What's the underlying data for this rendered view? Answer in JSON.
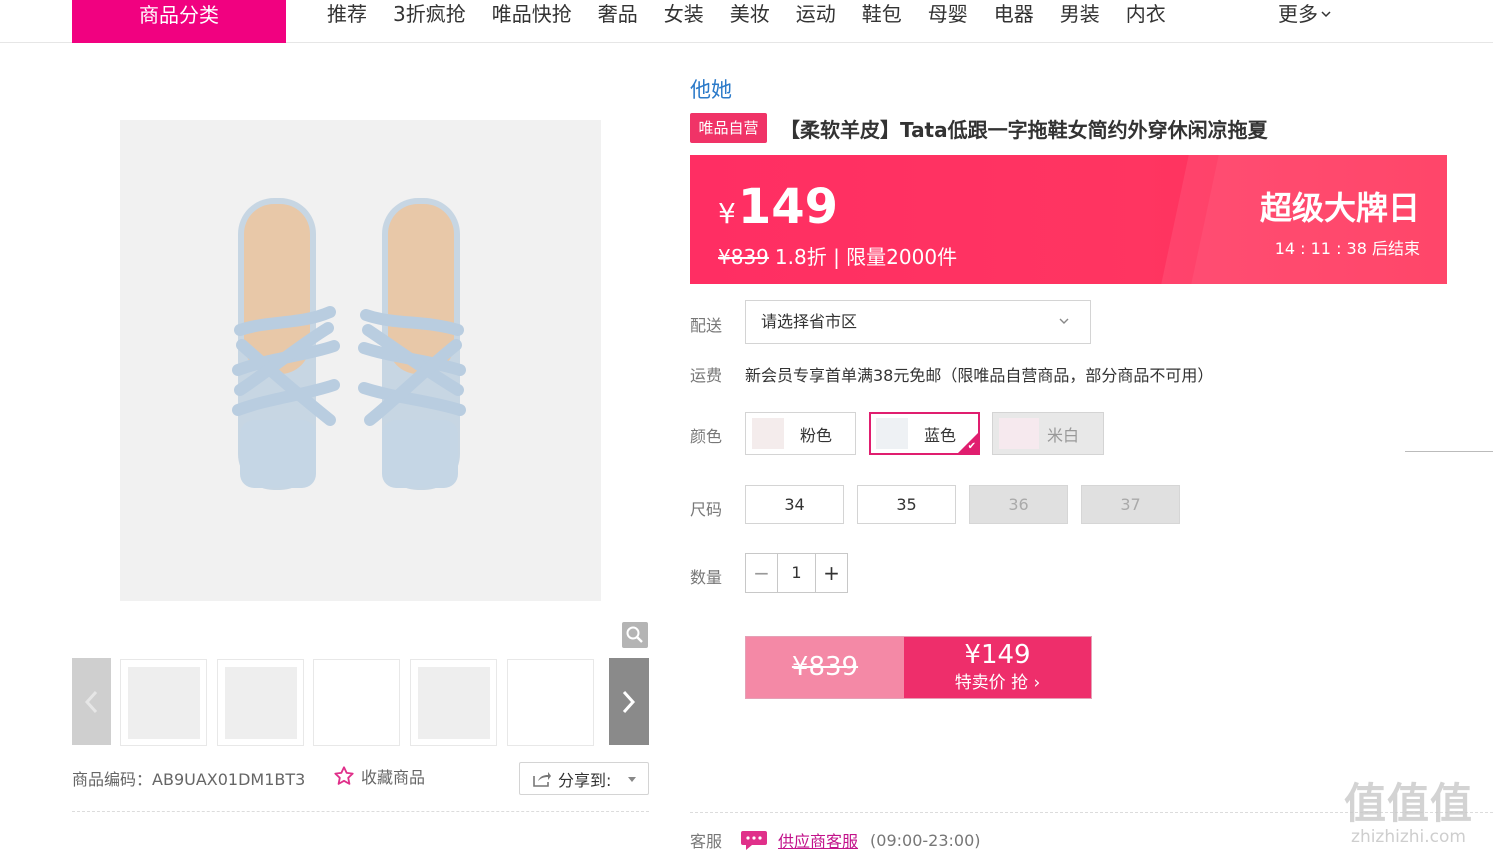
{
  "nav": {
    "category_button": "商品分类",
    "items": [
      "推荐",
      "3折疯抢",
      "唯品快抢",
      "奢品",
      "女装",
      "美妆",
      "运动",
      "鞋包",
      "母婴",
      "电器",
      "男装",
      "内衣"
    ],
    "more": "更多"
  },
  "gallery": {
    "product_code_label": "商品编码：",
    "product_code": "AB9UAX01DM1BT3",
    "favorite_label": "收藏商品",
    "share_label": "分享到:"
  },
  "product": {
    "brand": "他她",
    "self_badge": "唯品自营",
    "title": "【柔软羊皮】Tata低跟一字拖鞋女简约外穿休闲凉拖夏"
  },
  "price_banner": {
    "currency": "¥",
    "price": "149",
    "original_price": "¥839",
    "discount_info": "1.8折 | 限量2000件",
    "event_title": "超级大牌日",
    "countdown": "14 : 11 : 38  后结束"
  },
  "delivery": {
    "label": "配送",
    "placeholder": "请选择省市区"
  },
  "shipping": {
    "label": "运费",
    "text": "新会员专享首单满38元免邮（限唯品自营商品，部分商品不可用）"
  },
  "color": {
    "label": "颜色",
    "options": [
      {
        "name": "粉色",
        "state": "available"
      },
      {
        "name": "蓝色",
        "state": "selected"
      },
      {
        "name": "米白",
        "state": "disabled"
      }
    ]
  },
  "size": {
    "label": "尺码",
    "options": [
      {
        "name": "34",
        "state": "available"
      },
      {
        "name": "35",
        "state": "available"
      },
      {
        "name": "36",
        "state": "disabled"
      },
      {
        "name": "37",
        "state": "disabled"
      }
    ]
  },
  "quantity": {
    "label": "数量",
    "value": "1",
    "minus": "−",
    "plus": "+"
  },
  "buy": {
    "original_price": "¥839",
    "price": "¥149",
    "action": "特卖价 抢 ›"
  },
  "service": {
    "label": "客服",
    "link": "供应商客服",
    "hours": "(09:00-23:00)"
  },
  "watermark": {
    "logo": "值值值",
    "domain": "zhizhizhi.com"
  },
  "colors": {
    "brand_pink": "#f10180",
    "banner_red": "#ff2e63",
    "link_blue": "#2b7ac9",
    "service_purple": "#c2128a"
  }
}
